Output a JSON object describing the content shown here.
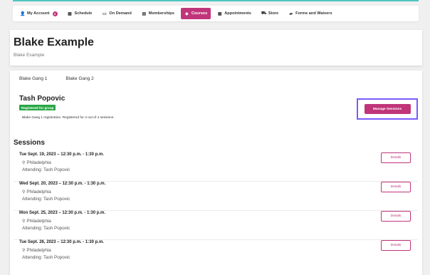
{
  "nav": {
    "items": [
      {
        "label": "My Account",
        "icon": "user-icon",
        "glyph": "👤",
        "badge": "1"
      },
      {
        "label": "Schedule",
        "icon": "calendar-icon",
        "glyph": "▦"
      },
      {
        "label": "On Demand",
        "icon": "video-icon",
        "glyph": "▭"
      },
      {
        "label": "Memberships",
        "icon": "id-card-icon",
        "glyph": "▤"
      },
      {
        "label": "Courses",
        "icon": "graduation-cap-icon",
        "glyph": "◈",
        "active": true
      },
      {
        "label": "Appointments",
        "icon": "calendar-check-icon",
        "glyph": "▦"
      },
      {
        "label": "Store",
        "icon": "cart-icon",
        "glyph": "⛟"
      },
      {
        "label": "Forms and Waivers",
        "icon": "folder-icon",
        "glyph": "▰"
      }
    ],
    "accent": "#c0357a"
  },
  "header": {
    "title": "Blake Example",
    "subtitle": "Blake Example"
  },
  "tabs": [
    "Blake Gang 1",
    "Blake Gang 2"
  ],
  "student": {
    "name": "Tash Popovic",
    "status_badge": "Registered for group",
    "registration_note": "Blake Gang 1 registration. Registered for 4 out of 4 sessions.",
    "manage_label": "Manage Sessions"
  },
  "sessions_title": "Sessions",
  "sessions": [
    {
      "date": "Tue Sept. 19, 2023 – 12:30 p.m. - 1:30 p.m.",
      "location": "Philadelphia",
      "attending": "Attending: Tash Popovic",
      "details_label": "Details"
    },
    {
      "date": "Wed Sept. 20, 2023 – 12:30 p.m. - 1:30 p.m.",
      "location": "Philadelphia",
      "attending": "Attending: Tash Popovic",
      "details_label": "Details"
    },
    {
      "date": "Mon Sept. 25, 2023 – 12:30 p.m. - 1:30 p.m.",
      "location": "Philadelphia",
      "attending": "Attending: Tash Popovic",
      "details_label": "Details"
    },
    {
      "date": "Tue Sept. 26, 2023 – 12:30 p.m. - 1:30 p.m.",
      "location": "Philadelphia",
      "attending": "Attending: Tash Popovic",
      "details_label": "Details"
    }
  ],
  "colors": {
    "accent": "#c0357a",
    "success": "#28a745",
    "highlight": "#7b5cff",
    "topline": "#4ec5c1"
  }
}
